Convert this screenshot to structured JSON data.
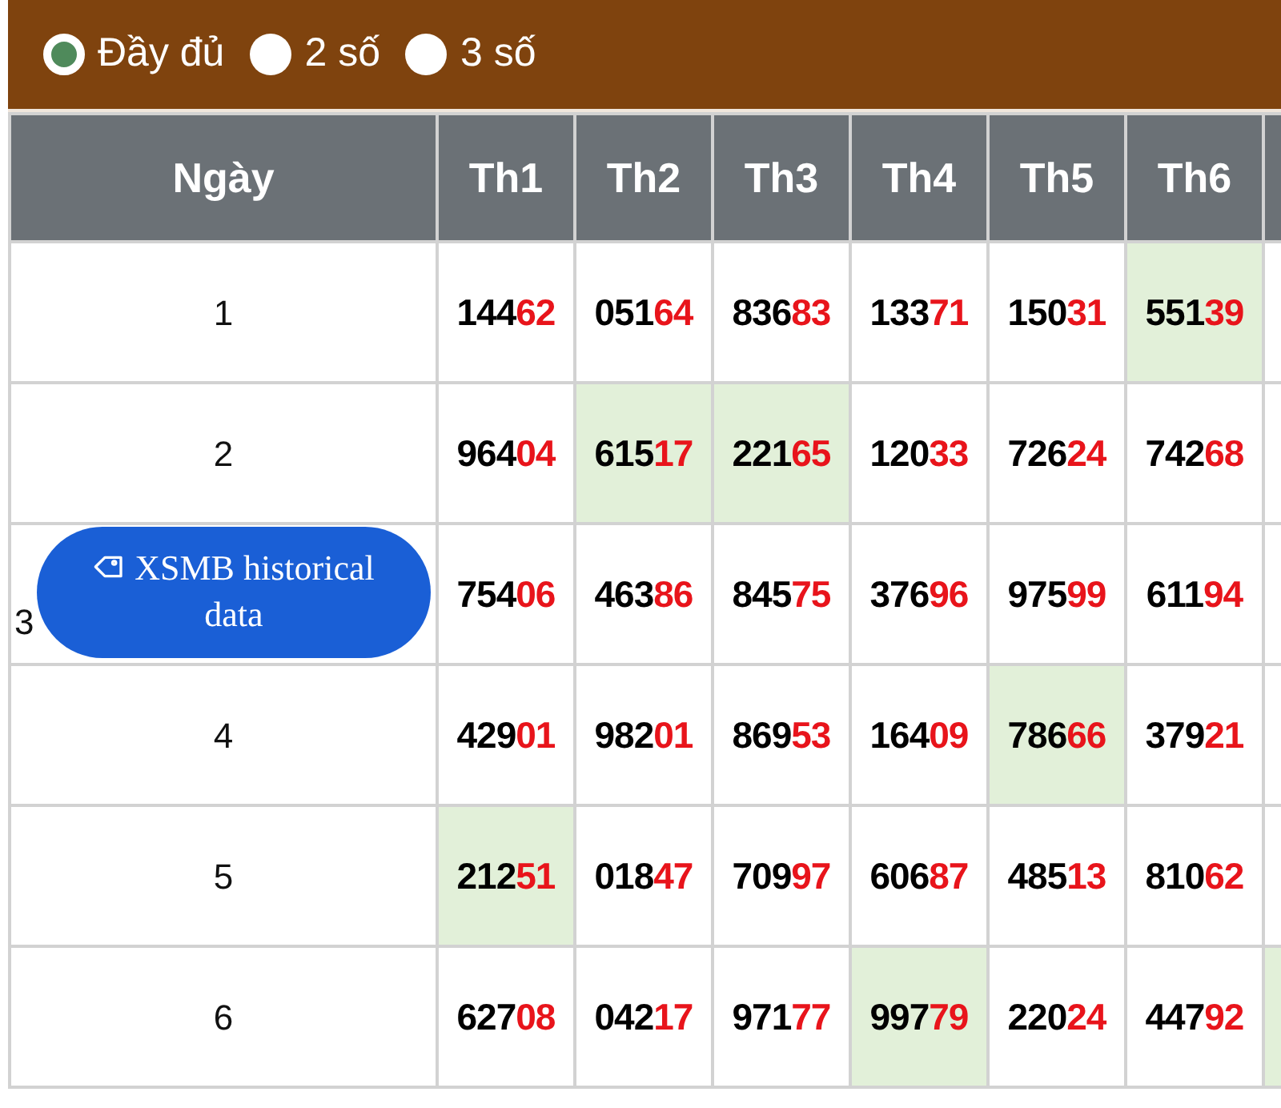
{
  "options": [
    {
      "label": "Đầy đủ",
      "selected": true
    },
    {
      "label": "2 số",
      "selected": false
    },
    {
      "label": "3 số",
      "selected": false
    }
  ],
  "table": {
    "columns": [
      "Ngày",
      "Th1",
      "Th2",
      "Th3",
      "Th4",
      "Th5",
      "Th6"
    ],
    "rows": [
      {
        "cells": [
          {
            "kind": "day",
            "text": "1"
          },
          {
            "kind": "number",
            "prefix": "144",
            "suffix": "62",
            "highlighted": false
          },
          {
            "kind": "number",
            "prefix": "051",
            "suffix": "64",
            "highlighted": false
          },
          {
            "kind": "number",
            "prefix": "836",
            "suffix": "83",
            "highlighted": false
          },
          {
            "kind": "number",
            "prefix": "133",
            "suffix": "71",
            "highlighted": false
          },
          {
            "kind": "number",
            "prefix": "150",
            "suffix": "31",
            "highlighted": false
          },
          {
            "kind": "number",
            "prefix": "551",
            "suffix": "39",
            "highlighted": true
          }
        ],
        "column_8_highlighted": false
      },
      {
        "cells": [
          {
            "kind": "day",
            "text": "2"
          },
          {
            "kind": "number",
            "prefix": "964",
            "suffix": "04",
            "highlighted": false
          },
          {
            "kind": "number",
            "prefix": "615",
            "suffix": "17",
            "highlighted": true
          },
          {
            "kind": "number",
            "prefix": "221",
            "suffix": "65",
            "highlighted": true
          },
          {
            "kind": "number",
            "prefix": "120",
            "suffix": "33",
            "highlighted": false
          },
          {
            "kind": "number",
            "prefix": "726",
            "suffix": "24",
            "highlighted": false
          },
          {
            "kind": "number",
            "prefix": "742",
            "suffix": "68",
            "highlighted": false
          }
        ],
        "column_8_highlighted": false
      },
      {
        "cells": [
          {
            "kind": "day",
            "text": "3"
          },
          {
            "kind": "number",
            "prefix": "754",
            "suffix": "06",
            "highlighted": false
          },
          {
            "kind": "number",
            "prefix": "463",
            "suffix": "86",
            "highlighted": false
          },
          {
            "kind": "number",
            "prefix": "845",
            "suffix": "75",
            "highlighted": false
          },
          {
            "kind": "number",
            "prefix": "376",
            "suffix": "96",
            "highlighted": false
          },
          {
            "kind": "number",
            "prefix": "975",
            "suffix": "99",
            "highlighted": false
          },
          {
            "kind": "number",
            "prefix": "611",
            "suffix": "94",
            "highlighted": false
          }
        ],
        "column_8_highlighted": false
      },
      {
        "cells": [
          {
            "kind": "day",
            "text": "4"
          },
          {
            "kind": "number",
            "prefix": "429",
            "suffix": "01",
            "highlighted": false
          },
          {
            "kind": "number",
            "prefix": "982",
            "suffix": "01",
            "highlighted": false
          },
          {
            "kind": "number",
            "prefix": "869",
            "suffix": "53",
            "highlighted": false
          },
          {
            "kind": "number",
            "prefix": "164",
            "suffix": "09",
            "highlighted": false
          },
          {
            "kind": "number",
            "prefix": "786",
            "suffix": "66",
            "highlighted": true
          },
          {
            "kind": "number",
            "prefix": "379",
            "suffix": "21",
            "highlighted": false
          }
        ],
        "column_8_highlighted": false
      },
      {
        "cells": [
          {
            "kind": "day",
            "text": "5"
          },
          {
            "kind": "number",
            "prefix": "212",
            "suffix": "51",
            "highlighted": true
          },
          {
            "kind": "number",
            "prefix": "018",
            "suffix": "47",
            "highlighted": false
          },
          {
            "kind": "number",
            "prefix": "709",
            "suffix": "97",
            "highlighted": false
          },
          {
            "kind": "number",
            "prefix": "606",
            "suffix": "87",
            "highlighted": false
          },
          {
            "kind": "number",
            "prefix": "485",
            "suffix": "13",
            "highlighted": false
          },
          {
            "kind": "number",
            "prefix": "810",
            "suffix": "62",
            "highlighted": false
          }
        ],
        "column_8_highlighted": false
      },
      {
        "cells": [
          {
            "kind": "day",
            "text": "6"
          },
          {
            "kind": "number",
            "prefix": "627",
            "suffix": "08",
            "highlighted": false
          },
          {
            "kind": "number",
            "prefix": "042",
            "suffix": "17",
            "highlighted": false
          },
          {
            "kind": "number",
            "prefix": "971",
            "suffix": "77",
            "highlighted": false
          },
          {
            "kind": "number",
            "prefix": "997",
            "suffix": "79",
            "highlighted": true
          },
          {
            "kind": "number",
            "prefix": "220",
            "suffix": "24",
            "highlighted": false
          },
          {
            "kind": "number",
            "prefix": "447",
            "suffix": "92",
            "highlighted": false
          }
        ],
        "column_8_highlighted": true
      }
    ]
  },
  "badge": {
    "label": "XSMB historical data"
  }
}
